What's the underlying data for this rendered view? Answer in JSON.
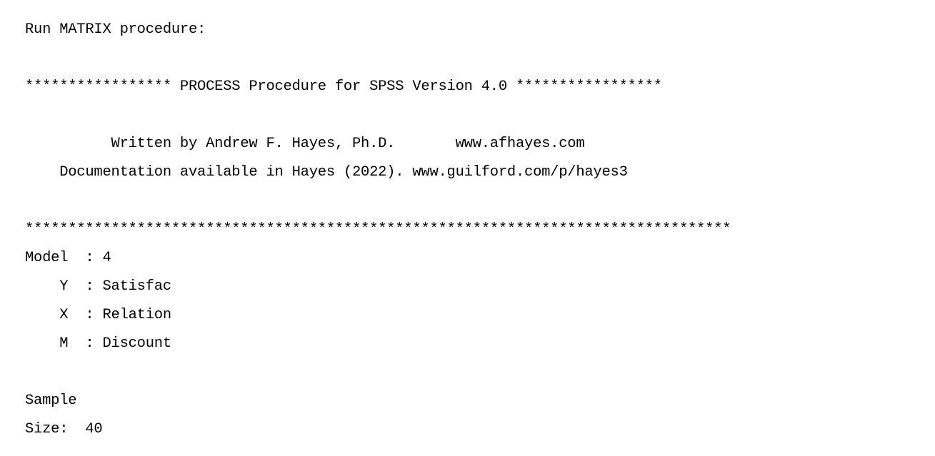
{
  "console": {
    "app": "SPSS Output Viewer",
    "background_color": "#ffffff",
    "text_color": "#000000",
    "lines": [
      {
        "id": "run-matrix",
        "text": "Run MATRIX procedure:"
      },
      {
        "id": "blank-1",
        "text": ""
      },
      {
        "id": "process-banner",
        "text": "***************** PROCESS Procedure for SPSS Version 4.0 *****************"
      },
      {
        "id": "blank-2",
        "text": ""
      },
      {
        "id": "author-line",
        "text": "          Written by Andrew F. Hayes, Ph.D.       www.afhayes.com"
      },
      {
        "id": "documentation-line",
        "text": "    Documentation available in Hayes (2022). www.guilford.com/p/hayes3"
      },
      {
        "id": "blank-3",
        "text": ""
      },
      {
        "id": "separator-rule",
        "text": "**********************************************************************************"
      },
      {
        "id": "model-line",
        "text": "Model  : 4"
      },
      {
        "id": "variable-y",
        "text": "    Y  : Satisfac"
      },
      {
        "id": "variable-x",
        "text": "    X  : Relation"
      },
      {
        "id": "variable-m",
        "text": "    M  : Discount"
      },
      {
        "id": "blank-4",
        "text": ""
      },
      {
        "id": "sample-label",
        "text": "Sample"
      },
      {
        "id": "sample-size",
        "text": "Size:  40"
      }
    ]
  },
  "details": {
    "procedure_title": "PROCESS Procedure for SPSS",
    "version": "4.0",
    "author": "Andrew F. Hayes, Ph.D.",
    "author_website": "www.afhayes.com",
    "documentation_citation": "Hayes (2022)",
    "documentation_url": "www.guilford.com/p/hayes3",
    "model_number": "4",
    "outcome_variable_y": "Satisfac",
    "predictor_variable_x": "Relation",
    "mediator_variable_m": "Discount",
    "sample_size": "40",
    "banner_asterisk_count_left": 17,
    "banner_asterisk_count_right": 17,
    "separator_asterisk_count": 82
  }
}
